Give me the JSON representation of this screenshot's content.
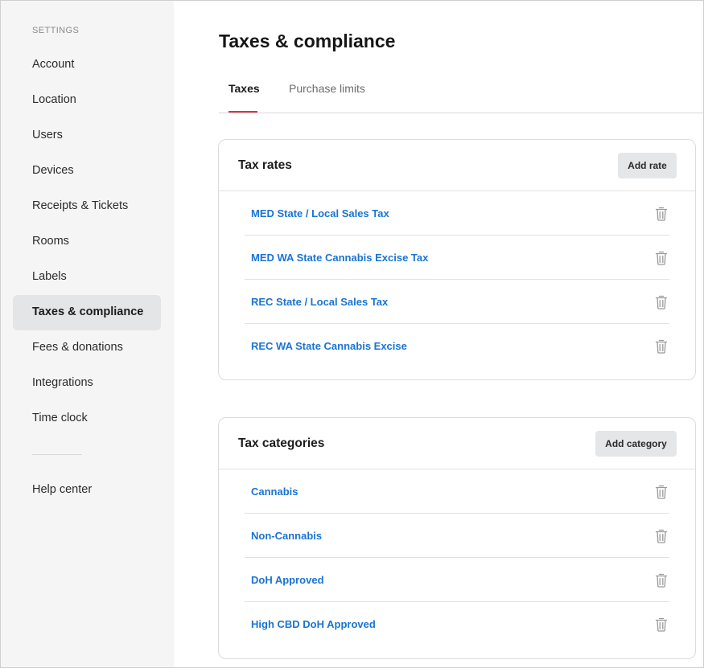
{
  "sidebar": {
    "heading": "SETTINGS",
    "items": [
      {
        "label": "Account",
        "active": false
      },
      {
        "label": "Location",
        "active": false
      },
      {
        "label": "Users",
        "active": false
      },
      {
        "label": "Devices",
        "active": false
      },
      {
        "label": "Receipts & Tickets",
        "active": false
      },
      {
        "label": "Rooms",
        "active": false
      },
      {
        "label": "Labels",
        "active": false
      },
      {
        "label": "Taxes & compliance",
        "active": true
      },
      {
        "label": "Fees & donations",
        "active": false
      },
      {
        "label": "Integrations",
        "active": false
      },
      {
        "label": "Time clock",
        "active": false
      }
    ],
    "help": "Help center"
  },
  "page": {
    "title": "Taxes & compliance",
    "tabs": [
      {
        "label": "Taxes",
        "active": true
      },
      {
        "label": "Purchase limits",
        "active": false
      }
    ]
  },
  "tax_rates": {
    "title": "Tax rates",
    "button": "Add rate",
    "items": [
      "MED State / Local Sales Tax",
      "MED WA State Cannabis Excise Tax",
      "REC State / Local Sales Tax",
      "REC WA State Cannabis Excise"
    ]
  },
  "tax_categories": {
    "title": "Tax categories",
    "button": "Add category",
    "items": [
      "Cannabis",
      "Non-Cannabis",
      "DoH Approved",
      "High CBD DoH Approved"
    ]
  },
  "colors": {
    "accent_red": "#e0313f",
    "link_blue": "#1a74d2",
    "sidebar_bg": "#f4f5f4",
    "active_item_bg": "#e3e5e6"
  },
  "icons": {
    "row_action": "trash-icon"
  }
}
